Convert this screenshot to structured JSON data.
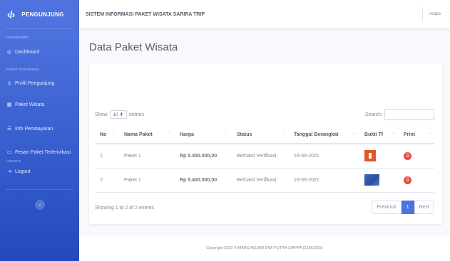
{
  "brand": {
    "logo": "‹/›",
    "name": "PENGUNJUNG"
  },
  "sidebar": {
    "heading_dashboard": "DASHBOARD",
    "heading_paket": "PAKET DAN PESAN",
    "heading_logout": "LOGOUT",
    "items": [
      {
        "label": "Dashboard",
        "icon": "dashboard-icon",
        "glyph": "◎"
      },
      {
        "label": "Profil Pengunjung",
        "icon": "user-icon",
        "glyph": "♙"
      },
      {
        "label": "Paket Wisata",
        "icon": "table-icon",
        "glyph": "▦"
      },
      {
        "label": "Info Pembayaran",
        "icon": "money-icon",
        "glyph": "☰"
      },
      {
        "label": "Pesan Paket Terlerivikasi",
        "icon": "card-icon",
        "glyph": "▭"
      },
      {
        "label": "Logout",
        "icon": "logout-icon",
        "glyph": "⇥"
      }
    ],
    "toggle_glyph": "‹"
  },
  "topbar": {
    "title": "SISTEM INFORMASI PAKET WISATA SARIRA TRIP",
    "user": "mdps"
  },
  "page": {
    "heading": "Data Paket Wisata"
  },
  "table_controls": {
    "show": "Show",
    "length_value": "10",
    "entries": "entries",
    "search_label": "Search:"
  },
  "table": {
    "columns": [
      "No",
      "Nama Paket",
      "Harga",
      "Status",
      "Tanggal Berangkat",
      "Bukti Tf",
      "Print"
    ],
    "rows": [
      {
        "no": "1",
        "nama": "Paket 1",
        "harga": "Rp 5.400.000,00",
        "status": "Berhasil Verifikasi",
        "tanggal": "16-09-2021"
      },
      {
        "no": "2",
        "nama": "Paket 1",
        "harga": "Rp 5.400.000,00",
        "status": "Berhasil Verifikasi",
        "tanggal": "16-09-2021"
      }
    ]
  },
  "pagination": {
    "info": "Showing 1 to 2 of 2 entries",
    "previous": "Previous",
    "current": "1",
    "next": "Next"
  },
  "footer": {
    "copyright": "Copyright 2022 © MARCHELINO DWI PUTRA SIAPPA (21661015)"
  },
  "colors": {
    "primary": "#4e73df",
    "danger": "#e74a3b"
  }
}
